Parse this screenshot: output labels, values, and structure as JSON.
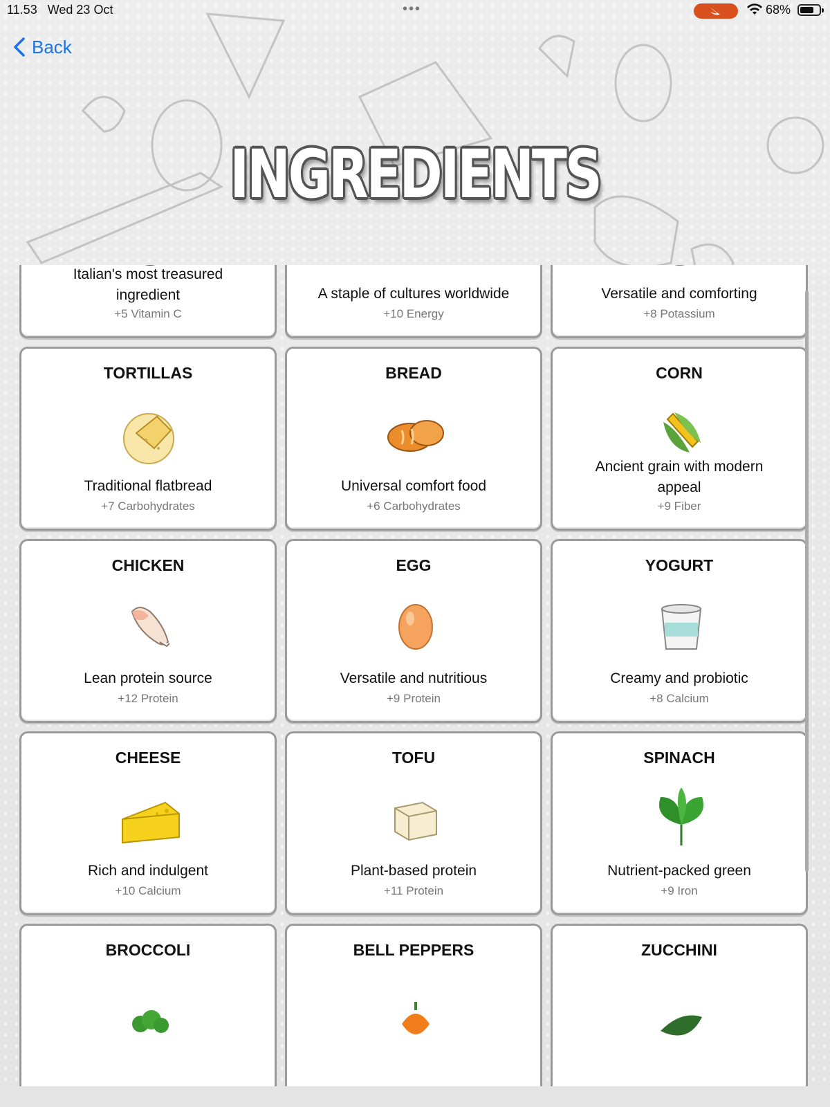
{
  "status_bar": {
    "time": "11.53",
    "date": "Wed 23 Oct",
    "battery": "68%",
    "recording_color": "#d9501f"
  },
  "nav": {
    "back_label": "Back"
  },
  "header": {
    "title": "INGREDIENTS"
  },
  "accent_color": "#1a73e8",
  "ingredients": [
    {
      "name": "",
      "icon": "tomato-icon",
      "description": "Italian's most treasured ingredient",
      "bonus": "+5 Vitamin C",
      "lines": 2
    },
    {
      "name": "",
      "icon": "rice-bowl-icon",
      "description": "A staple of cultures worldwide",
      "bonus": "+10 Energy",
      "lines": 1
    },
    {
      "name": "",
      "icon": "potato-icon",
      "description": "Versatile and comforting",
      "bonus": "+8 Potassium",
      "lines": 1
    },
    {
      "name": "TORTILLAS",
      "icon": "tortilla-icon",
      "description": "Traditional flatbread",
      "bonus": "+7 Carbohydrates",
      "lines": 1
    },
    {
      "name": "BREAD",
      "icon": "bread-icon",
      "description": "Universal comfort food",
      "bonus": "+6 Carbohydrates",
      "lines": 1
    },
    {
      "name": "CORN",
      "icon": "corn-icon",
      "description": "Ancient grain with modern appeal",
      "bonus": "+9 Fiber",
      "lines": 2
    },
    {
      "name": "CHICKEN",
      "icon": "chicken-icon",
      "description": "Lean protein source",
      "bonus": "+12 Protein",
      "lines": 1
    },
    {
      "name": "EGG",
      "icon": "egg-icon",
      "description": "Versatile and nutritious",
      "bonus": "+9 Protein",
      "lines": 1
    },
    {
      "name": "YOGURT",
      "icon": "yogurt-icon",
      "description": "Creamy and probiotic",
      "bonus": "+8 Calcium",
      "lines": 1
    },
    {
      "name": "CHEESE",
      "icon": "cheese-icon",
      "description": "Rich and indulgent",
      "bonus": "+10 Calcium",
      "lines": 1
    },
    {
      "name": "TOFU",
      "icon": "tofu-icon",
      "description": "Plant-based protein",
      "bonus": "+11 Protein",
      "lines": 1
    },
    {
      "name": "SPINACH",
      "icon": "spinach-icon",
      "description": "Nutrient-packed green",
      "bonus": "+9 Iron",
      "lines": 1
    },
    {
      "name": "BROCCOLI",
      "icon": "broccoli-icon",
      "description": "",
      "bonus": "",
      "lines": 1
    },
    {
      "name": "BELL PEPPERS",
      "icon": "bell-pepper-icon",
      "description": "",
      "bonus": "",
      "lines": 1
    },
    {
      "name": "ZUCCHINI",
      "icon": "zucchini-icon",
      "description": "",
      "bonus": "",
      "lines": 1
    }
  ]
}
